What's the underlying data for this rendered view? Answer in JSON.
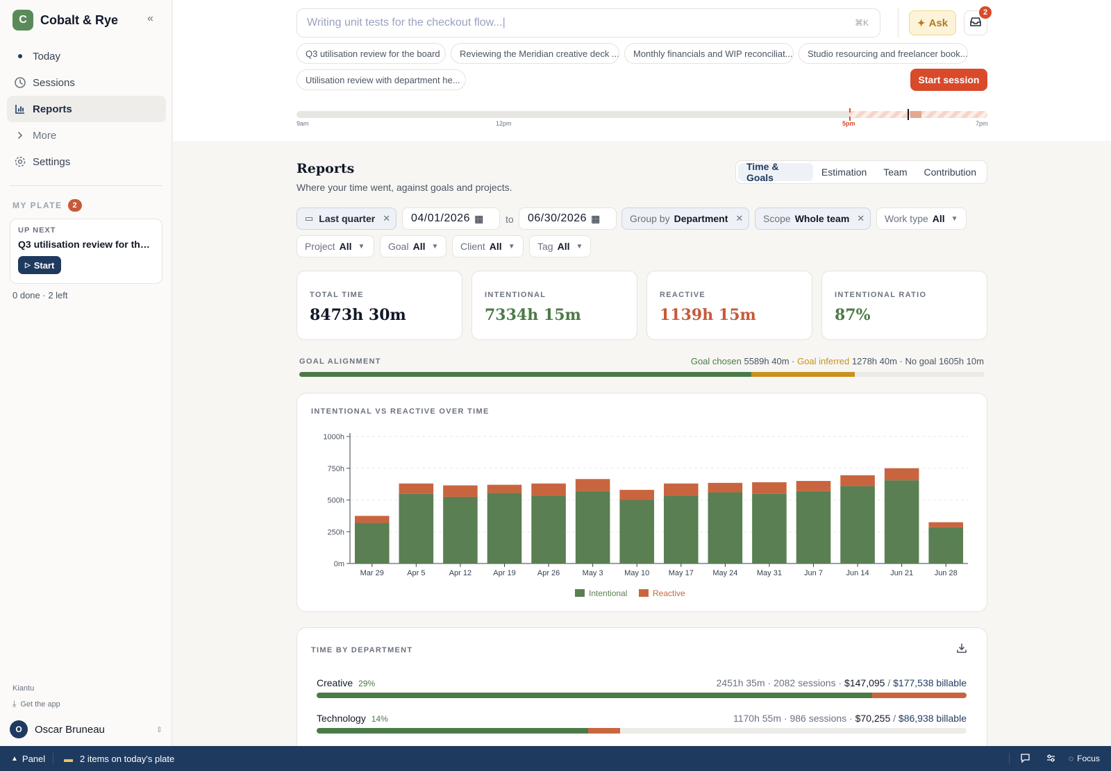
{
  "app": {
    "logo_letter": "C",
    "name": "Cobalt & Rye"
  },
  "nav": [
    {
      "label": "Today",
      "icon": "dot-icon"
    },
    {
      "label": "Sessions",
      "icon": "clock-icon"
    },
    {
      "label": "Reports",
      "icon": "bar-chart-icon",
      "active": true
    },
    {
      "label": "More",
      "icon": "chevron-right-icon"
    },
    {
      "label": "Settings",
      "icon": "gear-icon"
    }
  ],
  "plate": {
    "title": "MY PLATE",
    "count": "2",
    "up_next_label": "UP NEXT",
    "up_next_title": "Q3 utilisation review for the board",
    "start_label": "Start",
    "progress": "0 done · 2 left"
  },
  "footer": {
    "brand": "Kiantu",
    "get_app": "Get the app",
    "user_initial": "O",
    "user_name": "Oscar Bruneau"
  },
  "search": {
    "placeholder": "Writing unit tests for the checkout flow...|",
    "shortcut": "⌘K"
  },
  "ask_label": "Ask",
  "inbox_count": "2",
  "suggestions": [
    "Q3 utilisation review for the board",
    "Reviewing the Meridian creative deck ...",
    "Monthly financials and WIP reconciliat...",
    "Studio resourcing and freelancer book...",
    "Utilisation review with department he..."
  ],
  "start_session_label": "Start session",
  "timeline": {
    "labels": [
      "9am",
      "12pm",
      "5pm",
      "7pm"
    ]
  },
  "reports": {
    "title": "Reports",
    "subtitle": "Where your time went, against goals and projects.",
    "tabs": [
      "Time & Goals",
      "Estimation",
      "Team",
      "Contribution"
    ]
  },
  "filters": {
    "period": "Last quarter",
    "date_from": "04/01/2026",
    "to_label": "to",
    "date_to": "06/30/2026",
    "group_by": {
      "label": "Group by",
      "value": "Department"
    },
    "scope": {
      "label": "Scope",
      "value": "Whole team"
    },
    "work_type": {
      "label": "Work type",
      "value": "All"
    },
    "project": {
      "label": "Project",
      "value": "All"
    },
    "goal": {
      "label": "Goal",
      "value": "All"
    },
    "client": {
      "label": "Client",
      "value": "All"
    },
    "tag": {
      "label": "Tag",
      "value": "All"
    }
  },
  "stats": [
    {
      "label": "TOTAL TIME",
      "value": "8473h 30m",
      "color": "#111827"
    },
    {
      "label": "INTENTIONAL",
      "value": "7334h 15m",
      "color": "#4b7a47"
    },
    {
      "label": "REACTIVE",
      "value": "1139h 15m",
      "color": "#c65a3a"
    },
    {
      "label": "INTENTIONAL RATIO",
      "value": "87%",
      "color": "#4b7a47"
    }
  ],
  "goal_alignment": {
    "title": "GOAL ALIGNMENT",
    "chosen_label": "Goal chosen",
    "chosen_value": "5589h 40m",
    "inferred_label": "Goal inferred",
    "inferred_value": "1278h 40m",
    "none_label": "No goal",
    "none_value": "1605h 10m",
    "chosen_hours": 5589.67,
    "inferred_hours": 1278.67,
    "none_hours": 1605.17,
    "colors": {
      "chosen": "#4b7a47",
      "inferred": "#c8921e"
    }
  },
  "chart_title": "INTENTIONAL VS REACTIVE OVER TIME",
  "chart_data": {
    "type": "bar",
    "stacked": true,
    "categories": [
      "Mar 29",
      "Apr 5",
      "Apr 12",
      "Apr 19",
      "Apr 26",
      "May 3",
      "May 10",
      "May 17",
      "May 24",
      "May 31",
      "Jun 7",
      "Jun 14",
      "Jun 21",
      "Jun 28"
    ],
    "series": [
      {
        "name": "Intentional",
        "color": "#5a7f52",
        "values": [
          320,
          550,
          525,
          555,
          535,
          570,
          500,
          535,
          560,
          550,
          570,
          610,
          655,
          285
        ]
      },
      {
        "name": "Reactive",
        "color": "#c8653f",
        "values": [
          55,
          80,
          90,
          65,
          95,
          95,
          80,
          95,
          75,
          90,
          80,
          85,
          95,
          40
        ]
      }
    ],
    "y_ticks": [
      "0m",
      "250h",
      "500h",
      "750h",
      "1000h"
    ],
    "ylim": [
      0,
      1000
    ],
    "grid": true,
    "legend": "bottom"
  },
  "departments": {
    "title": "TIME BY DEPARTMENT",
    "items": [
      {
        "name": "Creative",
        "pct": "29%",
        "hours": "2451h 35m",
        "sessions": "2082 sessions",
        "amount": "$147,095",
        "billable": "$177,538 billable",
        "intentional_frac": 0.855,
        "reactive_frac": 0.145,
        "bar_frac": 1.0
      },
      {
        "name": "Technology",
        "pct": "14%",
        "hours": "1170h 55m",
        "sessions": "986 sessions",
        "amount": "$70,255",
        "billable": "$86,938 billable",
        "intentional_frac": 0.895,
        "reactive_frac": 0.105,
        "bar_frac": 0.467
      }
    ]
  },
  "bottombar": {
    "panel_label": "Panel",
    "plate_text": "2 items on today's plate",
    "focus_label": "Focus"
  }
}
